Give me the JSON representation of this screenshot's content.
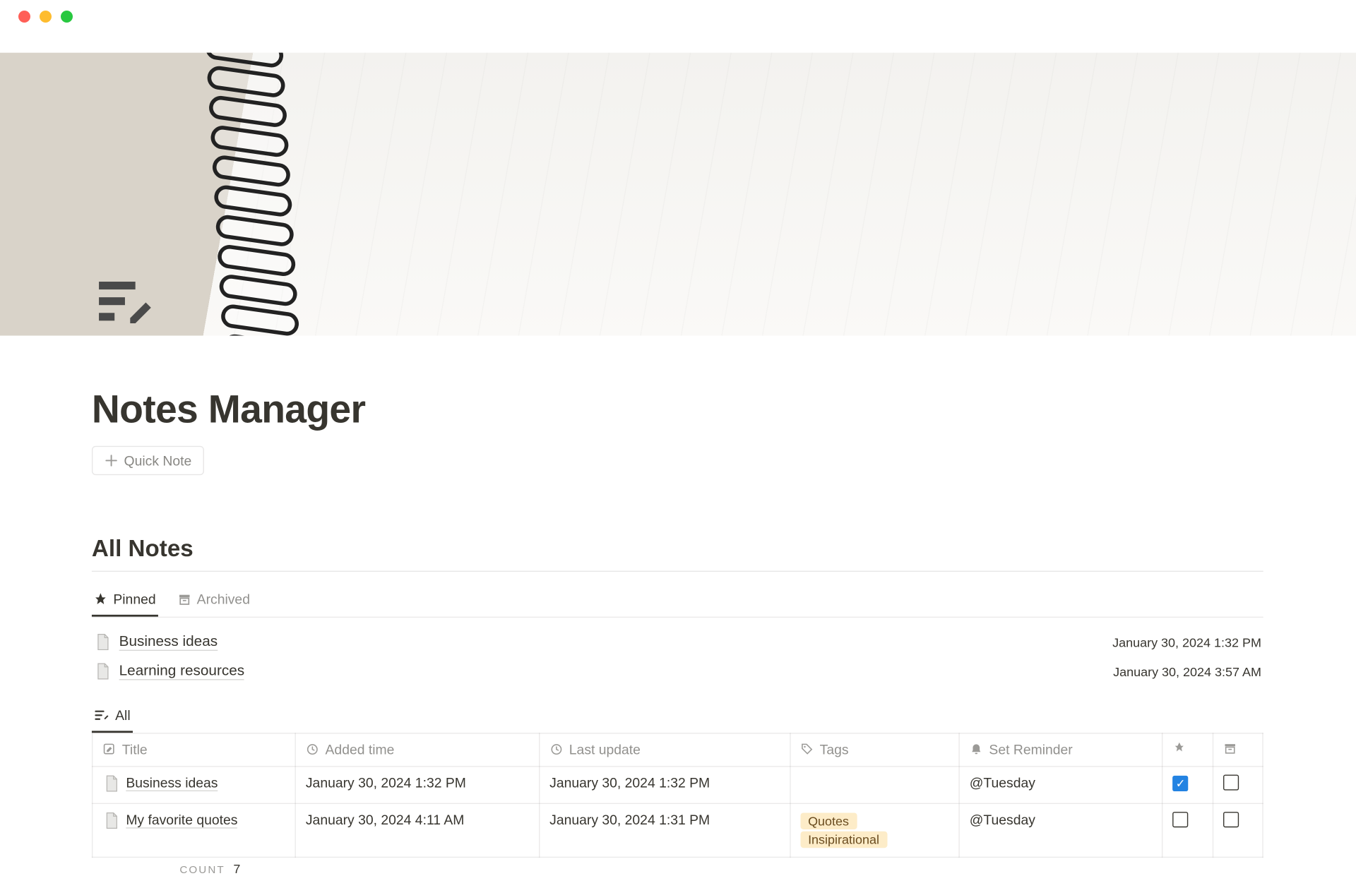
{
  "page": {
    "title": "Notes Manager",
    "quick_note_label": "Quick Note",
    "section_heading": "All Notes"
  },
  "tabs": {
    "pinned": "Pinned",
    "archived": "Archived"
  },
  "pinned_list": [
    {
      "name": "Business ideas",
      "date": "January 30, 2024 1:32 PM"
    },
    {
      "name": "Learning resources",
      "date": "January 30, 2024 3:57 AM"
    }
  ],
  "all_view": {
    "tab_label": "All",
    "columns": {
      "title": "Title",
      "added": "Added time",
      "updated": "Last update",
      "tags": "Tags",
      "reminder": "Set Reminder"
    },
    "rows": [
      {
        "title": "Business ideas",
        "added": "January 30, 2024 1:32 PM",
        "updated": "January 30, 2024 1:32 PM",
        "tags": [],
        "reminder": "@Tuesday",
        "pinned": true,
        "archived": false
      },
      {
        "title": "My favorite quotes",
        "added": "January 30, 2024 4:11 AM",
        "updated": "January 30, 2024 1:31 PM",
        "tags": [
          "Quotes",
          "Insipirational"
        ],
        "reminder": "@Tuesday",
        "pinned": false,
        "archived": false
      }
    ],
    "count_label": "COUNT",
    "count_value": "7"
  }
}
